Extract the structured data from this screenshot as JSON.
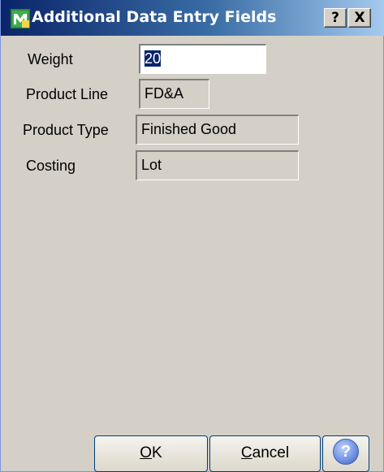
{
  "window": {
    "title": "Additional Data Entry Fields",
    "help_button": "?",
    "close_button": "X"
  },
  "fields": {
    "weight": {
      "label": "Weight",
      "value": "20"
    },
    "product_line": {
      "label": "Product Line",
      "value": "FD&A"
    },
    "product_type": {
      "label": "Product Type",
      "value": "Finished Good"
    },
    "costing": {
      "label": "Costing",
      "value": "Lot"
    }
  },
  "buttons": {
    "ok_mnemonic": "O",
    "ok_rest": "K",
    "cancel_mnemonic": "C",
    "cancel_rest": "ancel",
    "help_symbol": "?"
  },
  "icons": {
    "app": "mas-app-icon",
    "help": "help-circle-icon"
  },
  "colors": {
    "dialog_bg": "#d4d0c8",
    "title_start": "#0a246a",
    "selection": "#0a246a"
  }
}
